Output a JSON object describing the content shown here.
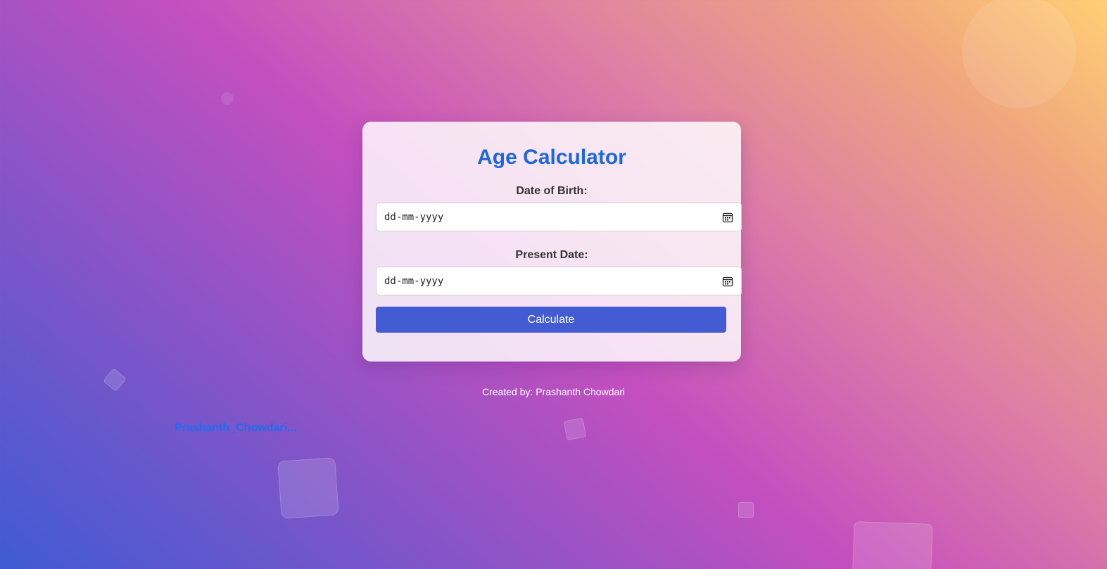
{
  "app": {
    "title": "Age Calculator"
  },
  "form": {
    "dob_label": "Date of Birth:",
    "dob_placeholder": "dd-mm-yyyy",
    "present_label": "Present Date:",
    "present_placeholder": "dd-mm-yyyy",
    "calculate_label": "Calculate"
  },
  "footer": {
    "credit": "Created by: Prashanth Chowdari",
    "author_link": "Prashanth_Chowdari..."
  },
  "icons": {
    "dob_icon": "calendar-icon",
    "present_icon": "calendar-icon"
  },
  "colors": {
    "title": "#1e66de",
    "button": "#435cd4",
    "link": "#1a6ef0"
  }
}
